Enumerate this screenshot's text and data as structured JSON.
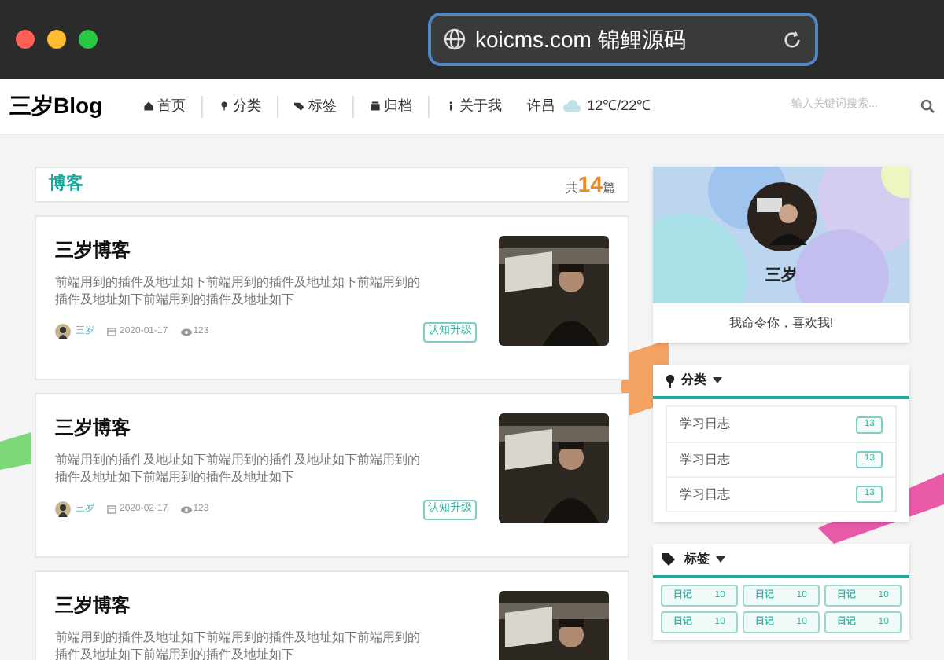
{
  "browser": {
    "url": "koicms.com 锦鲤源码"
  },
  "nav": {
    "logo": "三岁Blog",
    "items": [
      {
        "kind": "home",
        "label": "首页"
      },
      {
        "kind": "pin",
        "label": "分类"
      },
      {
        "kind": "tag",
        "label": "标签"
      },
      {
        "kind": "archive",
        "label": "归档"
      },
      {
        "kind": "info",
        "label": "关于我"
      }
    ],
    "weather": {
      "city": "许昌",
      "temp": "12℃/22℃"
    },
    "search": {
      "placeholder": "输入关键词搜索..."
    }
  },
  "blog": {
    "title": "博客",
    "count_prefix": "共",
    "count": "14",
    "count_suffix": "篇",
    "posts": [
      {
        "title": "三岁博客",
        "excerpt": "前端用到的插件及地址如下前端用到的插件及地址如下前端用到的插件及地址如下前端用到的插件及地址如下",
        "author": "三岁",
        "date": "2020-01-17",
        "views": "123",
        "tag": "认知升级"
      },
      {
        "title": "三岁博客",
        "excerpt": "前端用到的插件及地址如下前端用到的插件及地址如下前端用到的插件及地址如下前端用到的插件及地址如下",
        "author": "三岁",
        "date": "2020-02-17",
        "views": "123",
        "tag": "认知升级"
      },
      {
        "title": "三岁博客",
        "excerpt": "前端用到的插件及地址如下前端用到的插件及地址如下前端用到的插件及地址如下前端用到的插件及地址如下"
      }
    ]
  },
  "profile": {
    "name": "三岁",
    "motto": "我命令你，喜欢我!"
  },
  "categories": {
    "title": "分类",
    "items": [
      {
        "label": "学习日志",
        "count": "13"
      },
      {
        "label": "学习日志",
        "count": "13"
      },
      {
        "label": "学习日志",
        "count": "13"
      }
    ]
  },
  "tags": {
    "title": "标签",
    "items": [
      {
        "label": "日记",
        "count": "10"
      },
      {
        "label": "日记",
        "count": "10"
      },
      {
        "label": "日记",
        "count": "10"
      },
      {
        "label": "日记",
        "count": "10"
      },
      {
        "label": "日记",
        "count": "10"
      },
      {
        "label": "日记",
        "count": "10"
      }
    ]
  }
}
